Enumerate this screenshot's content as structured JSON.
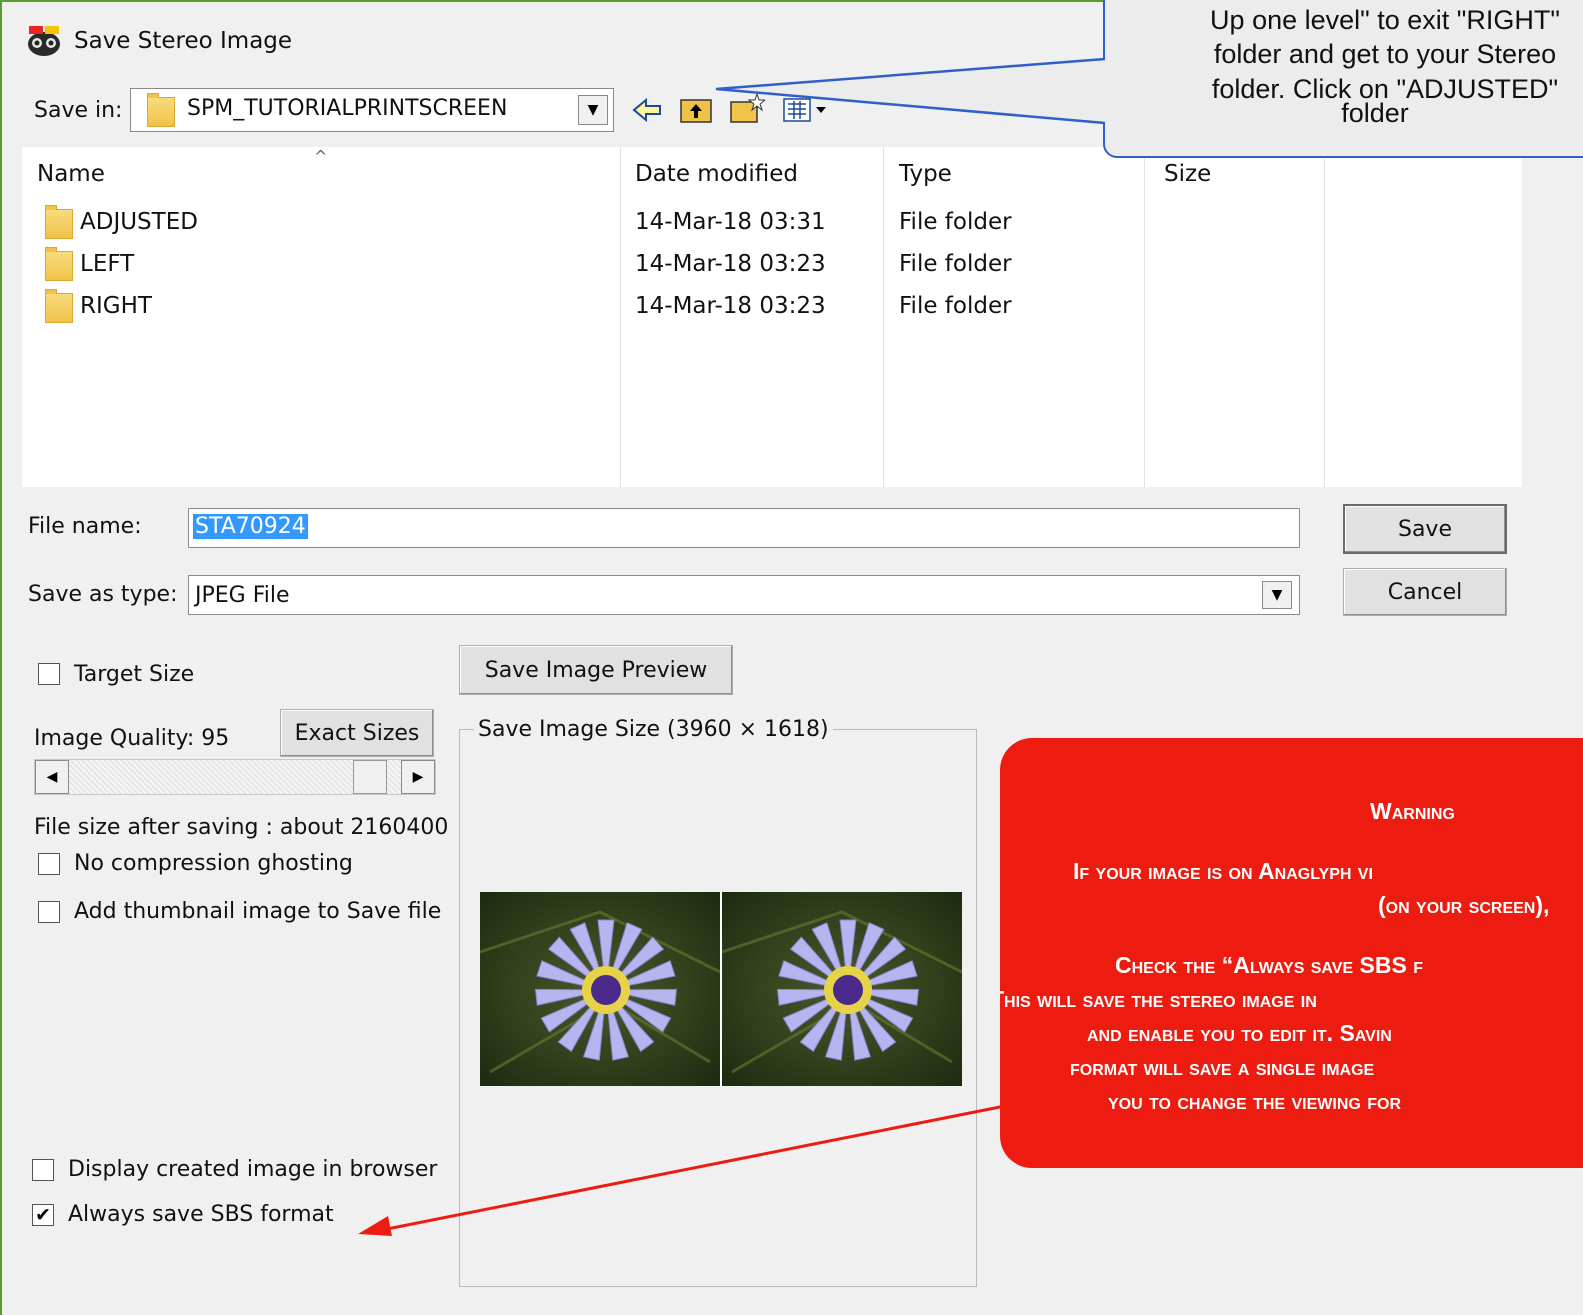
{
  "window": {
    "title": "Save Stereo Image",
    "icon": "stereo-camera-app-icon"
  },
  "save_in": {
    "label": "Save in:",
    "value": "SPM_TUTORIALPRINTSCREEN",
    "toolbar_icons": [
      "back-arrow-icon",
      "up-one-level-icon",
      "new-folder-icon",
      "view-menu-icon"
    ]
  },
  "file_list": {
    "columns": [
      "Name",
      "Date modified",
      "Type",
      "Size"
    ],
    "rows": [
      {
        "name": "ADJUSTED",
        "date": "14-Mar-18 03:31",
        "type": "File folder"
      },
      {
        "name": "LEFT",
        "date": "14-Mar-18 03:23",
        "type": "File folder"
      },
      {
        "name": "RIGHT",
        "date": "14-Mar-18 03:23",
        "type": "File folder"
      }
    ]
  },
  "file_name": {
    "label": "File name:",
    "value": "STA70924"
  },
  "save_as_type": {
    "label": "Save as type:",
    "value": "JPEG File"
  },
  "buttons": {
    "save": "Save",
    "cancel": "Cancel",
    "preview": "Save Image Preview",
    "exact_sizes": "Exact Sizes"
  },
  "options": {
    "target_size": {
      "label": "Target Size",
      "checked": false
    },
    "image_quality": {
      "label": "Image Quality: 95"
    },
    "file_size": "File size after saving : about 2160400",
    "no_compression_ghosting": {
      "label": "No compression ghosting",
      "checked": false
    },
    "add_thumbnail": {
      "label": "Add thumbnail image to Save file",
      "checked": false
    },
    "display_in_browser": {
      "label": "Display created image in browser",
      "checked": false
    },
    "always_sbs": {
      "label": "Always save SBS format",
      "checked": true
    }
  },
  "preview_group": {
    "label": "Save Image Size (3960 × 1618)"
  },
  "callout_blue": {
    "lines": [
      "Up one level\" to exit \"RIGHT\"",
      "folder and get to your Stereo",
      "folder. Click on \"ADJUSTED\"",
      "folder"
    ]
  },
  "callout_red": {
    "heading": "Warning",
    "lines": [
      "If your image is on Anaglyph vi",
      "(on your screen),",
      "Check the “Always save SBS f",
      "This will save the stereo image in",
      "and enable you to edit it. Savin",
      "format will save a single image",
      "you to change the viewing for"
    ]
  },
  "colors": {
    "accent_blue": "#2f5fc8",
    "warning_red": "#ee1c10",
    "selection": "#3399ff"
  }
}
